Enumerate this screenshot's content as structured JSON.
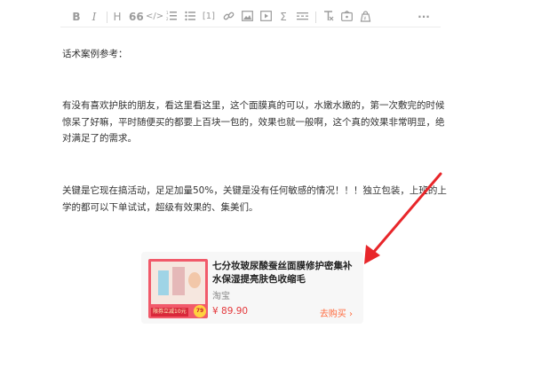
{
  "toolbar": {
    "items": [
      {
        "glyph": "B",
        "icon": "bold-icon"
      },
      {
        "glyph": "I",
        "icon": "italic-icon"
      },
      {
        "glyph": "H",
        "icon": "heading-icon"
      },
      {
        "glyph": "66",
        "icon": "quote-icon"
      },
      {
        "glyph": "</>",
        "icon": "code-icon"
      },
      {
        "glyph": "",
        "icon": "ordered-list-icon"
      },
      {
        "glyph": "",
        "icon": "unordered-list-icon"
      },
      {
        "glyph": "[1]",
        "icon": "footnote-icon"
      },
      {
        "glyph": "",
        "icon": "link-icon"
      },
      {
        "glyph": "",
        "icon": "image-icon"
      },
      {
        "glyph": "",
        "icon": "video-icon"
      },
      {
        "glyph": "Σ",
        "icon": "formula-icon"
      },
      {
        "glyph": "",
        "icon": "divider-icon"
      },
      {
        "glyph": "",
        "icon": "clear-format-icon"
      },
      {
        "glyph": "",
        "icon": "tag-icon"
      },
      {
        "glyph": "",
        "icon": "product-icon"
      },
      {
        "glyph": "···",
        "icon": "more-icon"
      }
    ]
  },
  "content": {
    "label": "话术案例参考：",
    "paragraph_one": "有没有喜欢护肤的朋友，看这里看这里，这个面膜真的可以，水嫩水嫩的，第一次敷完的时候惊呆了好嘛，平时随便买的都要上百块一包的，效果也就一般啊，这个真的效果非常明显，绝对满足了的需求。",
    "paragraph_two": "关键是它现在搞活动，足足加量50%，关键是没有任何敏感的情况！！！独立包装，上班的上学的都可以下单试试，超级有效果的、集美们。"
  },
  "product_card": {
    "title": "七分妆玻尿酸蚕丝面膜修护密集补水保湿提亮肤色收缩毛",
    "shop": "淘宝",
    "price": "¥ 89.90",
    "buy_label": "去购买 ›",
    "thumb_badge": "限券立减10元",
    "thumb_tag": "79"
  },
  "colors": {
    "toolbar_icon": "#9b9b9b",
    "price": "#e4393c",
    "buy": "#ff6a3d",
    "arrow": "#e8262a",
    "card_bg": "#f7f7f7"
  }
}
